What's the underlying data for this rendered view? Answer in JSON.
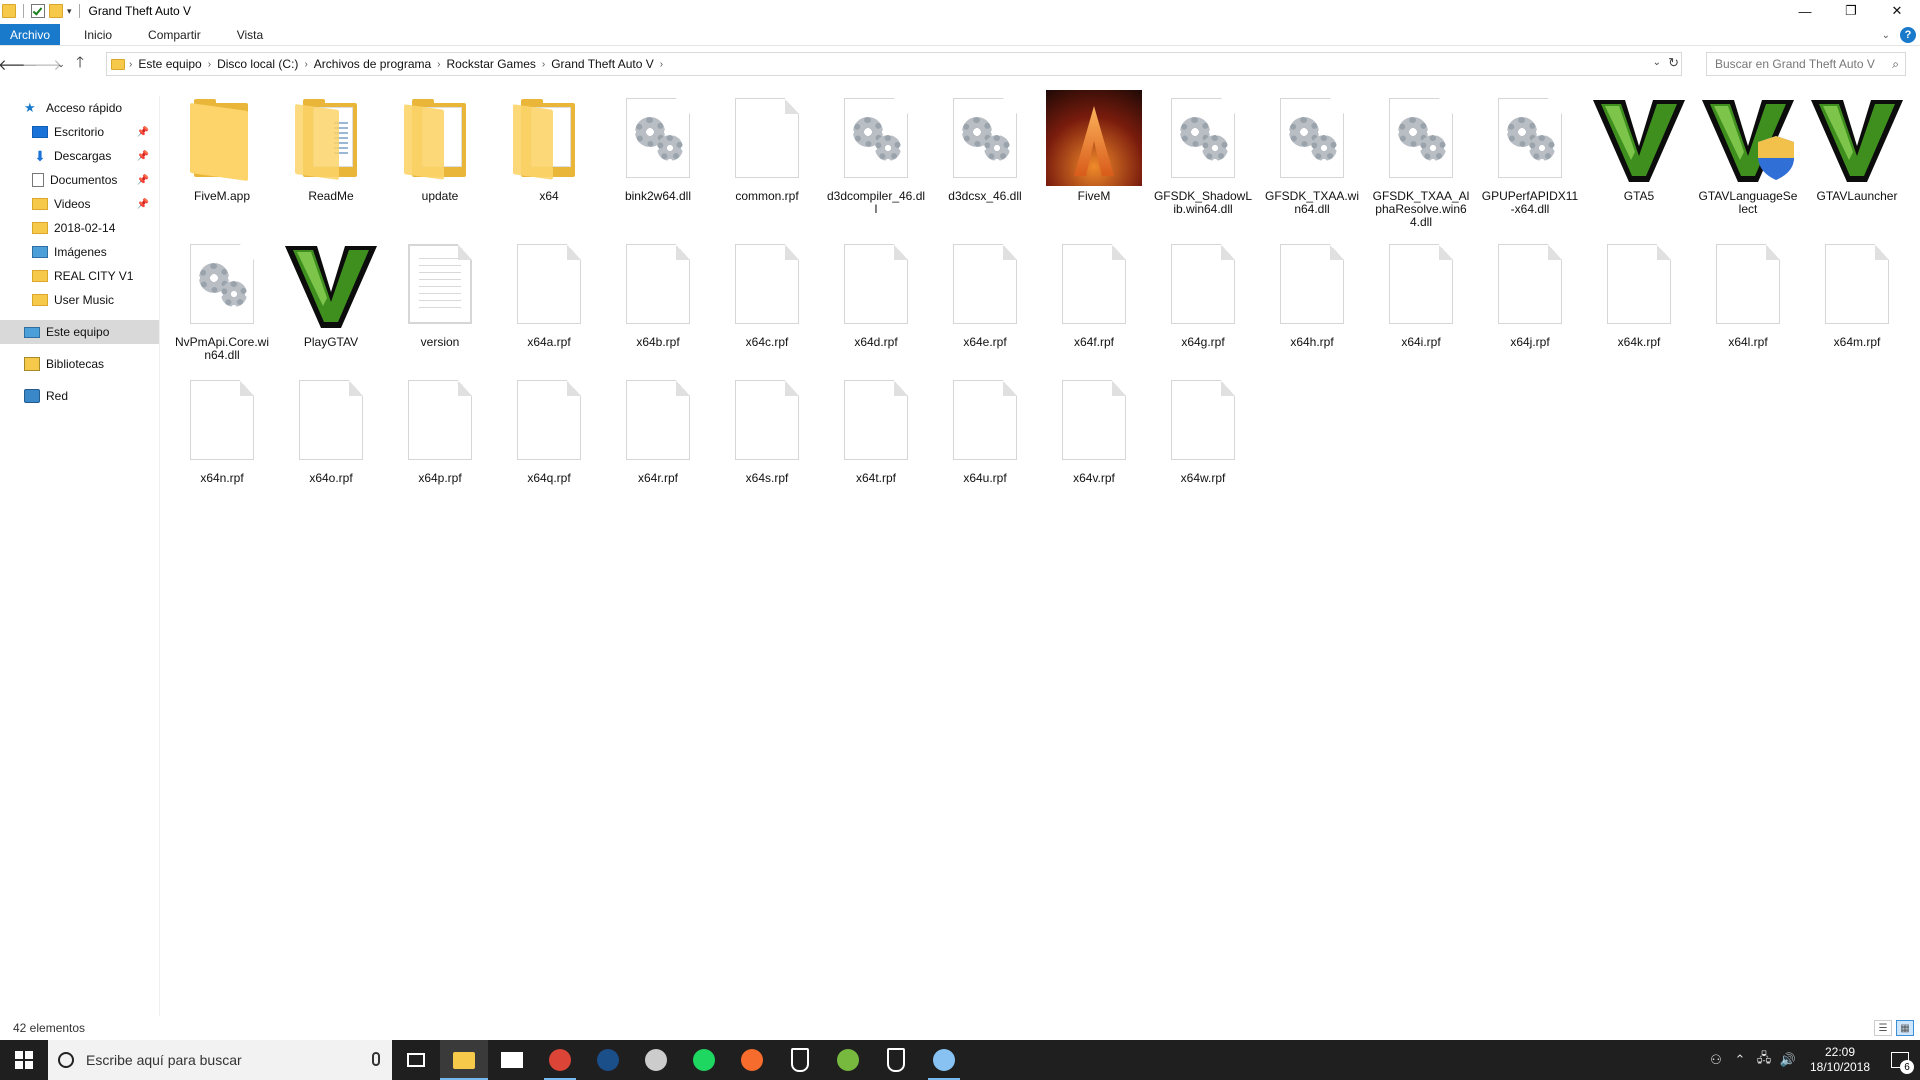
{
  "window": {
    "title": "Grand Theft Auto V",
    "controls": {
      "minimize": "—",
      "maximize": "❐",
      "close": "✕"
    }
  },
  "ribbon": {
    "tabs": [
      "Archivo",
      "Inicio",
      "Compartir",
      "Vista"
    ],
    "help": "?"
  },
  "address": {
    "crumbs": [
      "Este equipo",
      "Disco local (C:)",
      "Archivos de programa",
      "Rockstar Games",
      "Grand Theft Auto V"
    ]
  },
  "search": {
    "placeholder": "Buscar en Grand Theft Auto V"
  },
  "navpane": {
    "items": [
      {
        "label": "Acceso rápido",
        "icon": "star-icon",
        "pinned": false
      },
      {
        "label": "Escritorio",
        "icon": "desktop-icon",
        "pinned": true
      },
      {
        "label": "Descargas",
        "icon": "download-icon",
        "pinned": true
      },
      {
        "label": "Documentos",
        "icon": "document-icon",
        "pinned": true
      },
      {
        "label": "Videos",
        "icon": "folder-icon",
        "pinned": true
      },
      {
        "label": "2018-02-14",
        "icon": "folder-icon",
        "pinned": false
      },
      {
        "label": "Imágenes",
        "icon": "pictures-icon",
        "pinned": false
      },
      {
        "label": "REAL CITY V1",
        "icon": "folder-icon",
        "pinned": false
      },
      {
        "label": "User Music",
        "icon": "folder-icon",
        "pinned": false
      },
      {
        "label": "Este equipo",
        "icon": "computer-icon",
        "pinned": false
      },
      {
        "label": "Bibliotecas",
        "icon": "library-icon",
        "pinned": false
      },
      {
        "label": "Red",
        "icon": "network-icon",
        "pinned": false
      }
    ]
  },
  "files": [
    {
      "name": "FiveM.app",
      "type": "folder"
    },
    {
      "name": "ReadMe",
      "type": "folder-docs"
    },
    {
      "name": "update",
      "type": "folder-paper"
    },
    {
      "name": "x64",
      "type": "folder-paper"
    },
    {
      "name": "bink2w64.dll",
      "type": "dll"
    },
    {
      "name": "common.rpf",
      "type": "file"
    },
    {
      "name": "d3dcompiler_46.dll",
      "type": "dll"
    },
    {
      "name": "d3dcsx_46.dll",
      "type": "dll"
    },
    {
      "name": "FiveM",
      "type": "fivem"
    },
    {
      "name": "GFSDK_ShadowLib.win64.dll",
      "type": "dll"
    },
    {
      "name": "GFSDK_TXAA.win64.dll",
      "type": "dll"
    },
    {
      "name": "GFSDK_TXAA_AlphaResolve.win64.dll",
      "type": "dll"
    },
    {
      "name": "GPUPerfAPIDX11-x64.dll",
      "type": "dll"
    },
    {
      "name": "GTA5",
      "type": "gtav"
    },
    {
      "name": "GTAVLanguageSelect",
      "type": "gtav-shield"
    },
    {
      "name": "GTAVLauncher",
      "type": "gtav"
    },
    {
      "name": "NvPmApi.Core.win64.dll",
      "type": "dll"
    },
    {
      "name": "PlayGTAV",
      "type": "gtav"
    },
    {
      "name": "version",
      "type": "text"
    },
    {
      "name": "x64a.rpf",
      "type": "file"
    },
    {
      "name": "x64b.rpf",
      "type": "file"
    },
    {
      "name": "x64c.rpf",
      "type": "file"
    },
    {
      "name": "x64d.rpf",
      "type": "file"
    },
    {
      "name": "x64e.rpf",
      "type": "file"
    },
    {
      "name": "x64f.rpf",
      "type": "file"
    },
    {
      "name": "x64g.rpf",
      "type": "file"
    },
    {
      "name": "x64h.rpf",
      "type": "file"
    },
    {
      "name": "x64i.rpf",
      "type": "file"
    },
    {
      "name": "x64j.rpf",
      "type": "file"
    },
    {
      "name": "x64k.rpf",
      "type": "file"
    },
    {
      "name": "x64l.rpf",
      "type": "file"
    },
    {
      "name": "x64m.rpf",
      "type": "file"
    },
    {
      "name": "x64n.rpf",
      "type": "file"
    },
    {
      "name": "x64o.rpf",
      "type": "file"
    },
    {
      "name": "x64p.rpf",
      "type": "file"
    },
    {
      "name": "x64q.rpf",
      "type": "file"
    },
    {
      "name": "x64r.rpf",
      "type": "file"
    },
    {
      "name": "x64s.rpf",
      "type": "file"
    },
    {
      "name": "x64t.rpf",
      "type": "file"
    },
    {
      "name": "x64u.rpf",
      "type": "file"
    },
    {
      "name": "x64v.rpf",
      "type": "file"
    },
    {
      "name": "x64w.rpf",
      "type": "file"
    }
  ],
  "status": {
    "count": "42 elementos"
  },
  "taskbar": {
    "search_placeholder": "Escribe aquí para buscar",
    "apps": [
      {
        "name": "task-view",
        "color": "#ffffff"
      },
      {
        "name": "file-explorer",
        "color": "#f6c94b"
      },
      {
        "name": "mail",
        "color": "#ffffff"
      },
      {
        "name": "chrome",
        "color": "#db4437"
      },
      {
        "name": "steam",
        "color": "#1b4f8a"
      },
      {
        "name": "obs",
        "color": "#cccccc"
      },
      {
        "name": "spotify",
        "color": "#1ed760"
      },
      {
        "name": "origin",
        "color": "#f56c2d"
      },
      {
        "name": "epic-games",
        "color": "#ffffff"
      },
      {
        "name": "utorrent",
        "color": "#77b83f"
      },
      {
        "name": "epic-games-2",
        "color": "#ffffff"
      },
      {
        "name": "paint",
        "color": "#88c2f2"
      }
    ],
    "time": "22:09",
    "date": "18/10/2018",
    "notifications": "6"
  }
}
